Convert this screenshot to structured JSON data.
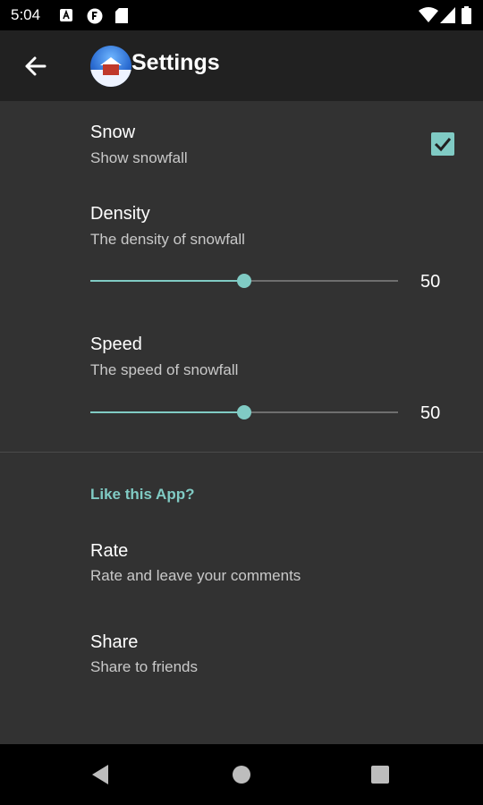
{
  "status_bar": {
    "time": "5:04"
  },
  "app_bar": {
    "title": "Settings"
  },
  "settings": {
    "snow": {
      "title": "Snow",
      "summary": "Show snowfall",
      "checked": true
    },
    "density": {
      "title": "Density",
      "summary": "The density of snowfall",
      "value": "50",
      "fraction": 0.5
    },
    "speed": {
      "title": "Speed",
      "summary": "The speed of snowfall",
      "value": "50",
      "fraction": 0.5
    }
  },
  "category": {
    "title": "Like this App?"
  },
  "rate": {
    "title": "Rate",
    "summary": "Rate and leave your comments"
  },
  "share": {
    "title": "Share",
    "summary": "Share to friends"
  },
  "colors": {
    "accent": "#80cbc4",
    "background": "#323232",
    "app_bar": "#212121"
  }
}
